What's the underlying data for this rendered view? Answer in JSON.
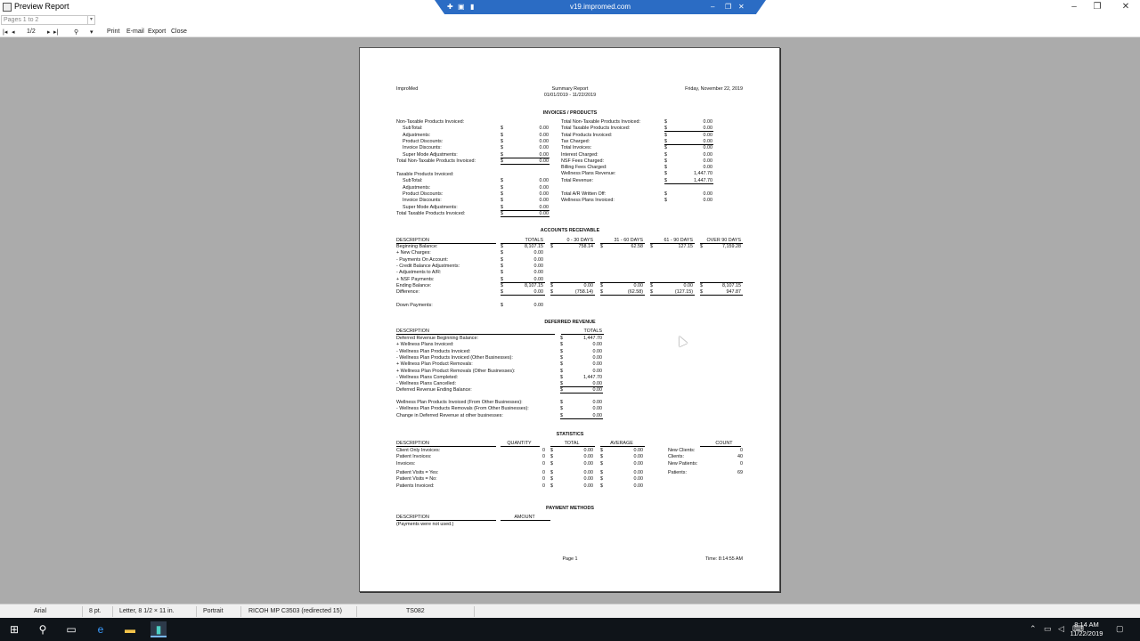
{
  "window": {
    "title": "Preview Report"
  },
  "remote": {
    "host": "v19.impromed.com"
  },
  "toolbar": {
    "page_range": "Pages 1 to 2",
    "page_counter": "1/2",
    "print_label": "Print",
    "email_label": "E-mail",
    "export_label": "Export",
    "close_label": "Close"
  },
  "report": {
    "company": "ImproMed",
    "title": "Summary Report",
    "date_range": "01/01/2019 - 11/22/2019",
    "report_date": "Friday, November 22, 2019",
    "footer_page": "Page 1",
    "footer_time": "Time: 8:14:55 AM",
    "invoices_products": {
      "heading": "INVOICES / PRODUCTS",
      "left_a": [
        [
          "Non-Taxable Products Invoiced:",
          "",
          ""
        ],
        [
          "SubTotal:",
          "$",
          "0.00"
        ],
        [
          "Adjustments:",
          "$",
          "0.00"
        ],
        [
          "Product Discounts:",
          "$",
          "0.00"
        ],
        [
          "Invoice Discounts:",
          "$",
          "0.00"
        ],
        [
          "Super Mode Adjustments:",
          "$",
          "0.00"
        ],
        [
          "Total Non-Taxable Products Invoiced:",
          "$",
          "0.00"
        ]
      ],
      "left_b": [
        [
          "Taxable Products Invoiced:",
          "",
          ""
        ],
        [
          "SubTotal:",
          "$",
          "0.00"
        ],
        [
          "Adjustments:",
          "$",
          "0.00"
        ],
        [
          "Product Discounts:",
          "$",
          "0.00"
        ],
        [
          "Invoice Discounts:",
          "$",
          "0.00"
        ],
        [
          "Super Mode Adjustments:",
          "$",
          "0.00"
        ],
        [
          "Total Taxable Products Invoiced:",
          "$",
          "0.00"
        ]
      ],
      "right": [
        [
          "Total Non-Taxable Products Invoiced:",
          "$",
          "0.00"
        ],
        [
          "Total Taxable Products Invoiced:",
          "$",
          "0.00"
        ],
        [
          "Total Products Invoiced:",
          "$",
          "0.00"
        ],
        [
          "Tax Charged:",
          "$",
          "0.00"
        ],
        [
          "Total Invoices:",
          "$",
          "0.00"
        ],
        [
          "Interest Charged:",
          "$",
          "0.00"
        ],
        [
          "NSF Fees Charged:",
          "$",
          "0.00"
        ],
        [
          "Billing Fees Charged:",
          "$",
          "0.00"
        ],
        [
          "Wellness Plans Revenue:",
          "$",
          "1,447.70"
        ],
        [
          "Total Revenue:",
          "$",
          "1,447.70"
        ]
      ],
      "right_b": [
        [
          "Total A/R Written Off:",
          "$",
          "0.00"
        ],
        [
          "Wellness Plans Invoiced:",
          "$",
          "0.00"
        ]
      ]
    },
    "ar": {
      "heading": "ACCOUNTS RECEIVABLE",
      "columns": [
        "DESCRIPTION",
        "TOTALS",
        "0 - 30 DAYS",
        "31 - 60 DAYS",
        "61 - 90 DAYS",
        "OVER 90 DAYS"
      ],
      "rows": [
        [
          "Beginning Balance:",
          "8,107.15",
          "758.14",
          "62.58",
          "127.15",
          "7,159.28"
        ],
        [
          "+ New Charges:",
          "0.00",
          "",
          "",
          "",
          ""
        ],
        [
          "- Payments On Account:",
          "0.00",
          "",
          "",
          "",
          ""
        ],
        [
          "- Credit Balance Adjustments:",
          "0.00",
          "",
          "",
          "",
          ""
        ],
        [
          "- Adjustments to A/R:",
          "0.00",
          "",
          "",
          "",
          ""
        ],
        [
          "+ NSF Payments:",
          "0.00",
          "",
          "",
          "",
          ""
        ],
        [
          "Ending Balance:",
          "8,107.15",
          "0.00",
          "0.00",
          "0.00",
          "8,107.15"
        ],
        [
          "Difference:",
          "0.00",
          "(758.14)",
          "(62.58)",
          "(127.15)",
          "947.87"
        ]
      ],
      "down_payments_label": "Down Payments:",
      "down_payments_value": "0.00"
    },
    "deferred": {
      "heading": "DEFERRED REVENUE",
      "col_desc": "DESCRIPTION",
      "col_totals": "TOTALS",
      "rows": [
        [
          "Deferred Revenue Beginning Balance:",
          "1,447.70"
        ],
        [
          "+ Wellness Plans Invoiced:",
          "0.00"
        ],
        [
          "- Wellness Plan Products Invoiced:",
          "0.00"
        ],
        [
          "- Wellness Plan Products Invoiced (Other Businesses):",
          "0.00"
        ],
        [
          "+ Wellness Plan Product Removals:",
          "0.00"
        ],
        [
          "+ Wellness Plan Product Removals (Other Businesses):",
          "0.00"
        ],
        [
          "- Wellness Plans Completed:",
          "1,447.70"
        ],
        [
          "- Wellness Plans Cancelled:",
          "0.00"
        ],
        [
          "Deferred Revenue Ending Balance:",
          "0.00"
        ]
      ],
      "rows_b": [
        [
          "Wellness Plan Products Invoiced (From Other Businesses):",
          "0.00"
        ],
        [
          "- Wellness Plan Products Removals (From Other Businesses):",
          "0.00"
        ],
        [
          "Change in Deferred Revenue at other businesses:",
          "0.00"
        ]
      ]
    },
    "stats": {
      "heading": "STATISTICS",
      "columns": [
        "DESCRIPTION",
        "QUANTITY",
        "TOTAL",
        "AVERAGE"
      ],
      "count_header": "COUNT",
      "rows": [
        [
          "Client Only Invoices:",
          "0",
          "0.00",
          "0.00"
        ],
        [
          "Patient Invoices:",
          "0",
          "0.00",
          "0.00"
        ],
        [
          "Invoices:",
          "0",
          "0.00",
          "0.00"
        ],
        [
          "Patient Visits = Yes:",
          "0",
          "0.00",
          "0.00"
        ],
        [
          "Patient Visits = No:",
          "0",
          "0.00",
          "0.00"
        ],
        [
          "Patients Invoiced:",
          "0",
          "0.00",
          "0.00"
        ]
      ],
      "counts": [
        [
          "New Clients:",
          "0"
        ],
        [
          "Clients:",
          "40"
        ],
        [
          "New Patients:",
          "0"
        ],
        [
          "Patients:",
          "69"
        ]
      ]
    },
    "payments": {
      "heading": "PAYMENT METHODS",
      "col_desc": "DESCRIPTION",
      "col_amount": "AMOUNT",
      "note": "(Payments were not used.)"
    }
  },
  "status": {
    "font": "Arial",
    "size": "8 pt.",
    "paper": "Letter, 8 1/2 × 11 in.",
    "orientation": "Portrait",
    "printer": "RICOH MP C3503 (redirected 15)",
    "code": "TS082"
  },
  "clock": {
    "time": "8:14 AM",
    "date": "11/22/2019"
  }
}
